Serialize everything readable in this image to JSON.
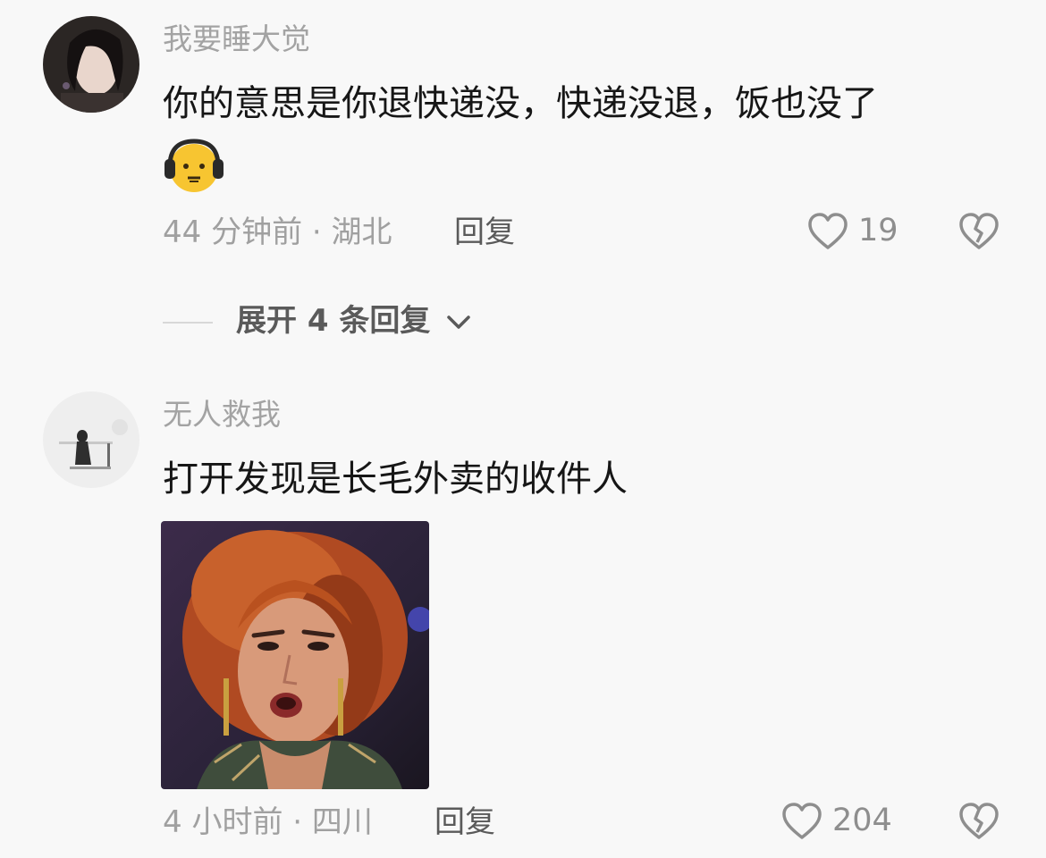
{
  "comments": [
    {
      "username": "我要睡大觉",
      "text": "你的意思是你退快递没，快递没退，饭也没了",
      "sticker": "headphone-face-emoji",
      "time_location": "44 分钟前 · 湖北",
      "reply_label": "回复",
      "likes": "19",
      "expand_replies": "展开 4 条回复"
    },
    {
      "username": "无人救我",
      "text": "打开发现是长毛外卖的收件人",
      "image": "woman-meme-photo",
      "time_location": "4 小时前 · 四川",
      "reply_label": "回复",
      "likes": "204"
    }
  ],
  "icons": {
    "like": "heart-outline-icon",
    "dislike": "broken-heart-icon",
    "expand": "chevron-down-icon"
  },
  "colors": {
    "background": "#f8f8f8",
    "username": "#a3a3a3",
    "text": "#161616",
    "meta": "#a0a0a0"
  }
}
